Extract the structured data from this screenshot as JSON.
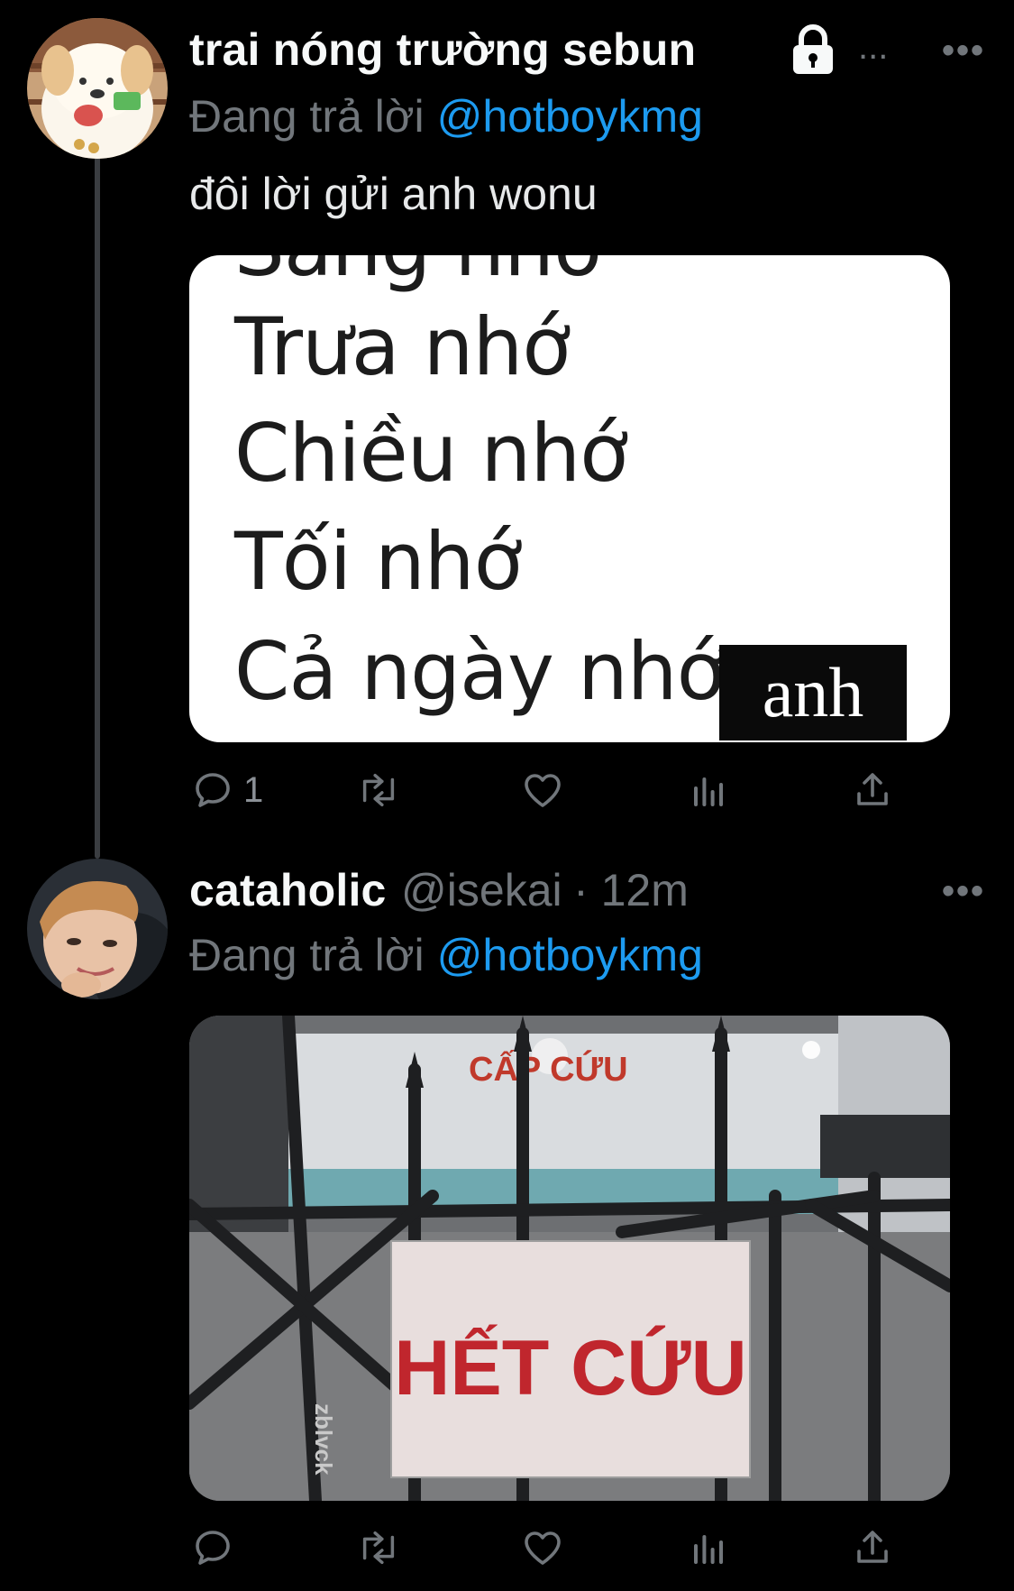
{
  "tweets": [
    {
      "display_name": "trai nóng trường sebun",
      "locked_icon": "lock-icon",
      "truncation": "...",
      "reply_prefix": "Đang trả lời",
      "reply_to": "@hotboykmg",
      "text": "đôi lời gửi anh wonu",
      "media": {
        "lines": [
          "Sáng nhớ",
          "Trưa nhớ",
          "Chiều nhớ",
          "Tối nhớ",
          "Cả ngày nhớ"
        ],
        "highlight": "anh"
      },
      "actions": {
        "reply_count": "1",
        "retweet_count": "",
        "like_count": ""
      }
    },
    {
      "display_name": "cataholic",
      "handle": "@isekai",
      "time": "· 12m",
      "reply_prefix": "Đang trả lời",
      "reply_to": "@hotboykmg",
      "media": {
        "sign_top": "CẤP CỨU",
        "sign_main": "HẾT CỨU",
        "watermark": "zblvck"
      }
    }
  ],
  "more_label": "•••",
  "icons": [
    "reply-icon",
    "retweet-icon",
    "like-icon",
    "views-icon",
    "share-icon",
    "more-icon",
    "lock-icon"
  ],
  "colors": {
    "background": "#000000",
    "mention": "#1d9bf0",
    "muted": "#71767b",
    "text": "#e7e9ea"
  }
}
